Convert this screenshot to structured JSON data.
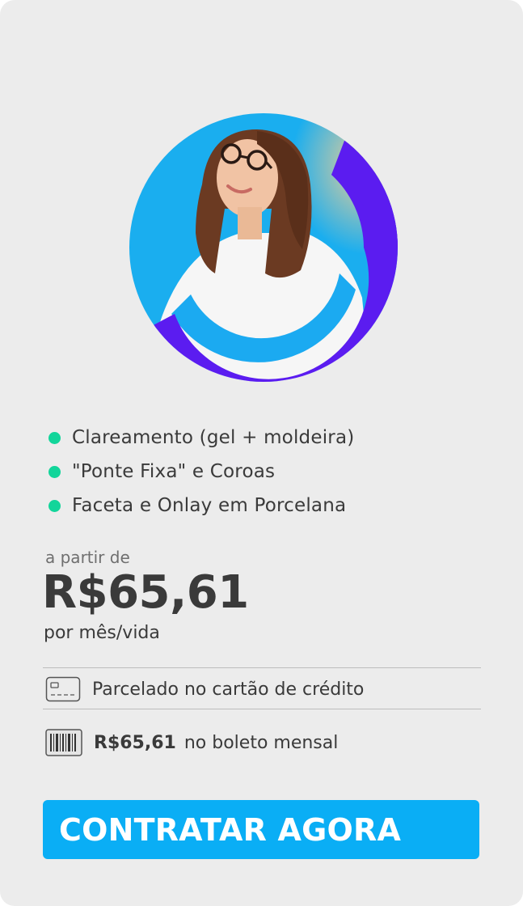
{
  "features": [
    "Clareamento (gel + moldeira)",
    "\"Ponte Fixa\" e Coroas",
    "Faceta e Onlay em Porcelana"
  ],
  "pricing": {
    "prefix": "a partir de",
    "value": "R$65,61",
    "period": "por mês/vida"
  },
  "payment": {
    "card_text": "Parcelado no cartão de crédito",
    "boleto_value": "R$65,61",
    "boleto_text": "no boleto mensal"
  },
  "cta": {
    "label": "CONTRATAR AGORA"
  },
  "colors": {
    "card_bg": "#ececec",
    "bullet": "#12d59a",
    "cta_bg": "#0aaef5",
    "ring_purple": "#5b1cf0",
    "ring_blue": "#0fa5f0"
  },
  "icons": {
    "card": "credit-card-icon",
    "boleto": "barcode-icon"
  }
}
